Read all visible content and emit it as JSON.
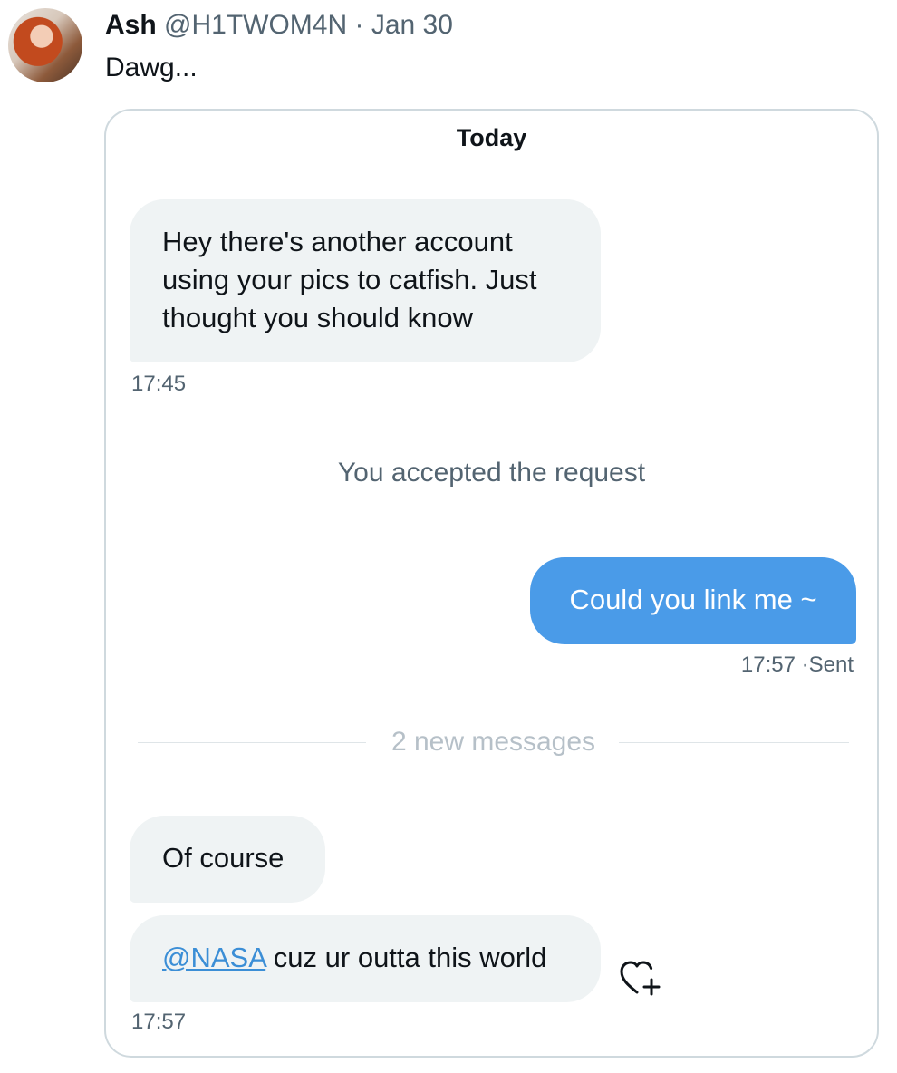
{
  "tweet": {
    "author_name": "Ash",
    "author_handle": "@H1TWOM4N",
    "separator": "·",
    "date": "Jan 30",
    "text": "Dawg..."
  },
  "chat": {
    "day_label": "Today",
    "messages": [
      {
        "direction": "incoming",
        "text": "Hey there's another account using your pics to catfish. Just thought you should know",
        "time": "17:45"
      },
      {
        "direction": "system",
        "text": "You accepted the request"
      },
      {
        "direction": "outgoing",
        "text": "Could you link me ~",
        "time": "17:57",
        "status": "Sent"
      },
      {
        "direction": "divider",
        "text": "2 new messages"
      },
      {
        "direction": "incoming",
        "text": "Of course"
      },
      {
        "direction": "incoming",
        "mention": "@NASA",
        "text": " cuz ur outta this world",
        "time": "17:57",
        "reaction_icon": "heart-plus-icon"
      }
    ]
  },
  "colors": {
    "outgoing_bubble": "#4a9be8",
    "incoming_bubble": "#eff3f4",
    "mention_link": "#3b8ed6",
    "secondary_text": "#536471"
  }
}
